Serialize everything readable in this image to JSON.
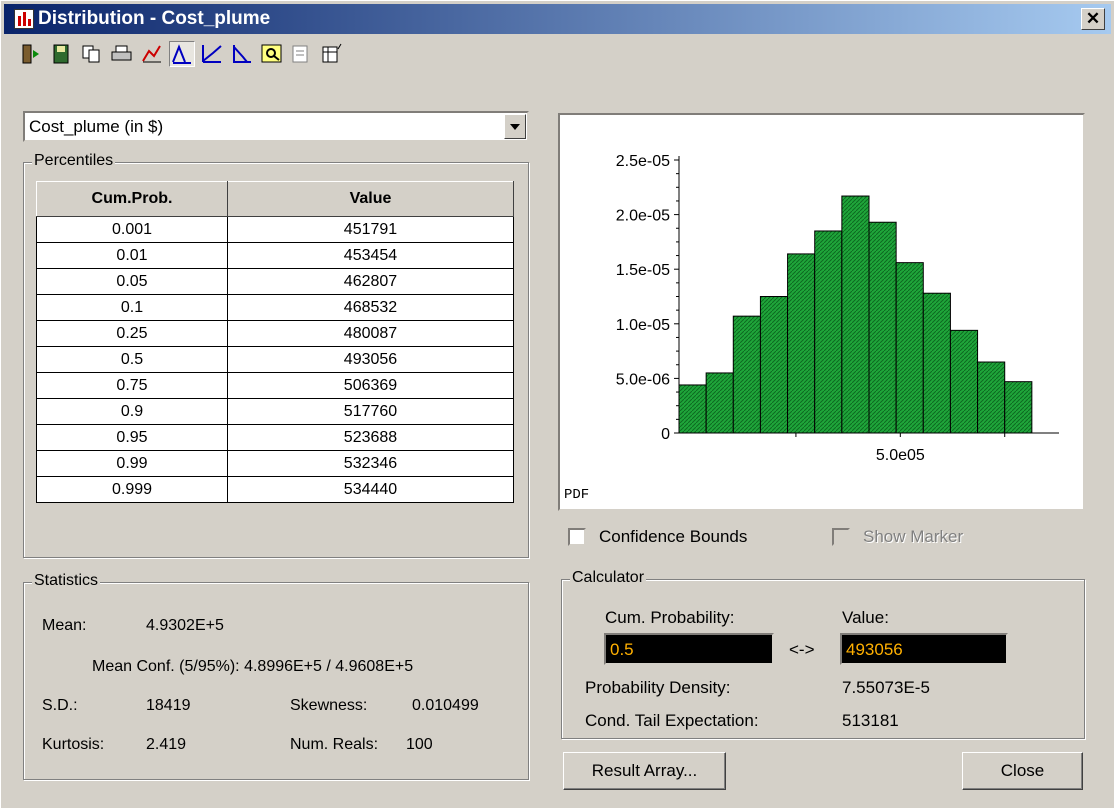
{
  "window": {
    "title": "Distribution - Cost_plume",
    "close_glyph": "✕"
  },
  "toolbar": {
    "icons": [
      "exit-icon",
      "save-icon",
      "copy-icon",
      "print-icon",
      "graph-setup-icon",
      "pdf-icon",
      "cdf-icon",
      "probability-bands-icon",
      "zoom-icon",
      "statistics-icon",
      "table-icon"
    ],
    "selected": "pdf-icon"
  },
  "variable_selector": {
    "value": "Cost_plume (in $)"
  },
  "percentiles": {
    "legend": "Percentiles",
    "headers": [
      "Cum.Prob.",
      "Value"
    ],
    "rows": [
      [
        "0.001",
        "451791"
      ],
      [
        "0.01",
        "453454"
      ],
      [
        "0.05",
        "462807"
      ],
      [
        "0.1",
        "468532"
      ],
      [
        "0.25",
        "480087"
      ],
      [
        "0.5",
        "493056"
      ],
      [
        "0.75",
        "506369"
      ],
      [
        "0.9",
        "517760"
      ],
      [
        "0.95",
        "523688"
      ],
      [
        "0.99",
        "532346"
      ],
      [
        "0.999",
        "534440"
      ]
    ]
  },
  "statistics": {
    "legend": "Statistics",
    "mean_label": "Mean:",
    "mean_value": "4.9302E+5",
    "mean_conf": "Mean Conf. (5/95%): 4.8996E+5 / 4.9608E+5",
    "sd_label": "S.D.:",
    "sd_value": "18419",
    "skewness_label": "Skewness:",
    "skewness_value": "0.010499",
    "kurtosis_label": "Kurtosis:",
    "kurtosis_value": "2.419",
    "numreals_label": "Num. Reals:",
    "numreals_value": "100"
  },
  "chart_data": {
    "type": "bar",
    "ylabel": "PDF",
    "xtick_labels": [
      "5.0e05"
    ],
    "ytick_labels": [
      "0",
      "5.0e-06",
      "1.0e-05",
      "1.5e-05",
      "2.0e-05",
      "2.5e-05"
    ],
    "ylim": [
      0,
      2.5e-05
    ],
    "xlim": [
      447000,
      538000
    ],
    "bin_start": 447000,
    "bin_width": 6500,
    "values": [
      4.4e-06,
      5.5e-06,
      1.07e-05,
      1.25e-05,
      1.64e-05,
      1.85e-05,
      2.17e-05,
      1.93e-05,
      1.56e-05,
      1.28e-05,
      9.4e-06,
      6.5e-06,
      4.7e-06
    ],
    "bar_color": "#1fa53a",
    "grid": false
  },
  "options": {
    "confidence_bounds": "Confidence Bounds",
    "confidence_bounds_checked": false,
    "show_marker": "Show Marker",
    "show_marker_checked": false
  },
  "calculator": {
    "legend": "Calculator",
    "cum_prob_label": "Cum. Probability:",
    "cum_prob_value": "0.5",
    "value_label": "Value:",
    "value_value": "493056",
    "arrow": "<->",
    "density_label": "Probability Density:",
    "density_value": "7.55073E-5",
    "cte_label": "Cond. Tail Expectation:",
    "cte_value": "513181"
  },
  "buttons": {
    "result_array": "Result Array...",
    "close": "Close"
  },
  "colors": {
    "title_active": "#0a246a",
    "calc_field_bg": "#000000",
    "calc_field_text": "#ffb000"
  }
}
